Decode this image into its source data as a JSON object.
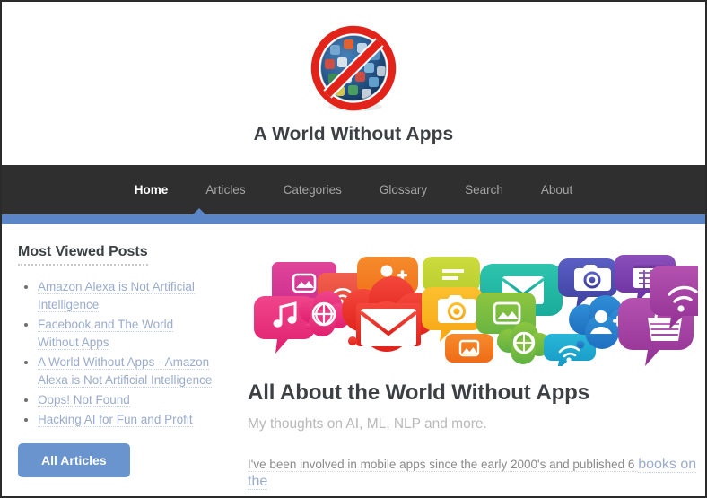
{
  "site": {
    "title": "A World Without Apps",
    "logo_icon": "no-apps-globe-icon"
  },
  "nav": {
    "items": [
      {
        "label": "Home",
        "active": true
      },
      {
        "label": "Articles",
        "active": false
      },
      {
        "label": "Categories",
        "active": false
      },
      {
        "label": "Glossary",
        "active": false
      },
      {
        "label": "Search",
        "active": false
      },
      {
        "label": "About",
        "active": false
      }
    ]
  },
  "sidebar": {
    "heading": "Most Viewed Posts",
    "posts": [
      "Amazon Alexa is Not Artificial Intelligence",
      "Facebook and The World Without Apps",
      "A World Without Apps - Amazon Alexa is Not Artificial Intelligence",
      "Oops! Not Found",
      "Hacking AI for Fun and Profit"
    ],
    "all_articles_label": "All Articles"
  },
  "main": {
    "banner_icon": "speech-bubbles-app-icons-banner",
    "title": "All About the World Without Apps",
    "subtitle": "My thoughts on AI, ML, NLP and more.",
    "paragraph_text": "I've been involved in mobile apps since the early 2000's and published 6 ",
    "paragraph_link": "books on the"
  },
  "colors": {
    "nav_background": "#2f2f2f",
    "accent_blue": "#5a86c7",
    "button_blue": "#6a94ce",
    "link_blue": "#9aaccd",
    "heading_dark": "#3c4043",
    "muted_text": "#8a8a8a",
    "nav_inactive": "#a4a4a4"
  }
}
